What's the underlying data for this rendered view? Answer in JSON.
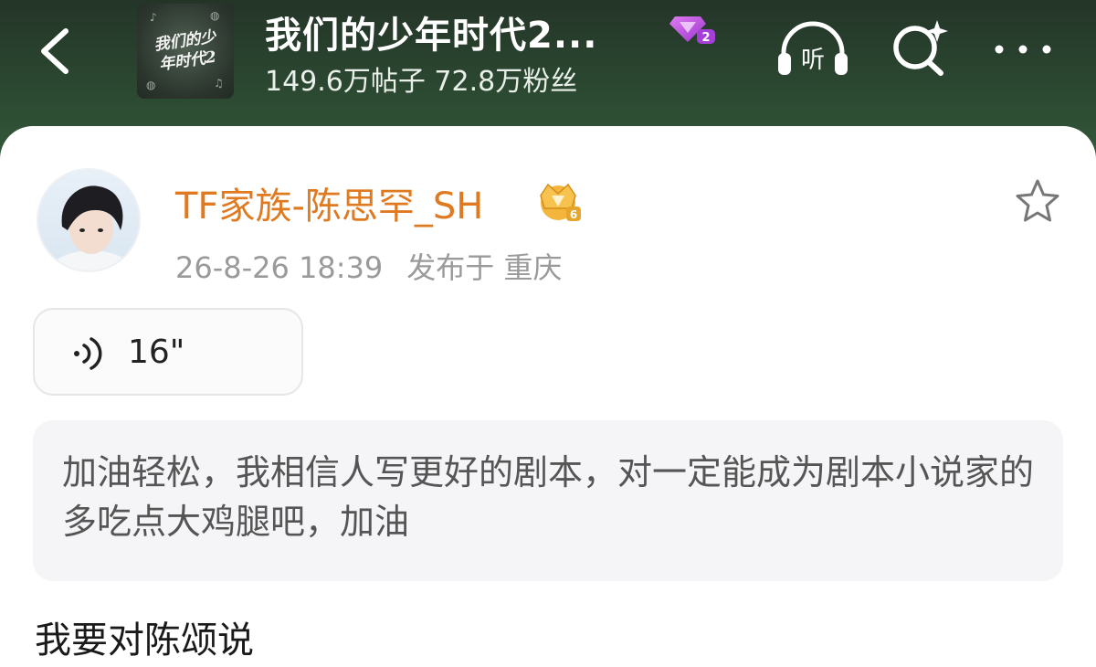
{
  "header": {
    "forum_title": "我们的少年时代2...",
    "forum_level_badge": "2",
    "stats": "149.6万帖子 72.8万粉丝",
    "cover_text": "我们的少年时代2",
    "icons": {
      "back": "chevron-left-icon",
      "listen": "headphones-listen-icon",
      "listen_label": "听",
      "search": "ai-search-icon",
      "more": "more-dots-icon"
    }
  },
  "post": {
    "author": "TF家族-陈思罕_SH",
    "author_badge": "6",
    "timestamp": "26-8-26 18:39",
    "location": "发布于 重庆",
    "voice_duration": "16\"",
    "quote": "加油轻松，我相信人写更好的剧本，对一定能成为剧本小说家的多吃点大鸡腿吧，加油",
    "body": "我要对陈颂说"
  },
  "colors": {
    "header_bg": "#2c4a32",
    "author_name": "#e07a20",
    "badge_purple": "#b24ad9",
    "badge_gold": "#e8a52b"
  }
}
